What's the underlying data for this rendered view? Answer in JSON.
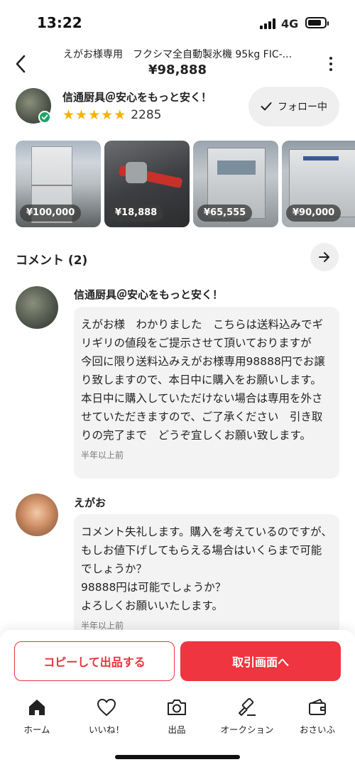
{
  "status_bar": {
    "time": "13:22",
    "network": "4G",
    "battery_level": 0.8
  },
  "header": {
    "title": "えがお様専用　フクシマ全自動製氷機 95kg FIC-...",
    "price": "¥98,888",
    "back_icon": "chevron-left-icon",
    "more_icon": "more-vertical-icon"
  },
  "seller": {
    "name": "信通厨具＠安心をもっと安く！",
    "rating_stars": 5,
    "rating_count": "2285",
    "follow_label": "フォロー中",
    "follow_icon": "check-icon"
  },
  "thumbnails": [
    {
      "price": "¥100,000"
    },
    {
      "price": "¥18,888"
    },
    {
      "price": "¥65,555"
    },
    {
      "price": "¥90,000"
    }
  ],
  "comments_section": {
    "title": "コメント (2)",
    "arrow_icon": "arrow-right-icon",
    "items": [
      {
        "author": "信通厨具＠安心をもっと安く！",
        "text": "えがお様　わかりました　こちらは送料込みでギリギリの値段をご提示させて頂いておりますが　今回に限り送料込みえがお様専用98888円でお譲り致しますので、本日中に購入をお願いします。本日中に購入していただけない場合は専用を外させていただきますので、ご了承ください　引き取りの完了まで　どうぞ宜しくお願い致します。",
        "time": "半年以上前"
      },
      {
        "author": "えがお",
        "text": "コメント失礼します。購入を考えているのですが、もしお値下げしてもらえる場合はいくらまで可能でしょうか？\n98888円は可能でしょうか？\nよろしくお願いいたします。",
        "time": "半年以上前"
      }
    ]
  },
  "actions": {
    "copy_label": "コピーして出品する",
    "trade_label": "取引画面へ",
    "brand_color": "#ee3540"
  },
  "tab_bar": [
    {
      "label": "ホーム",
      "icon": "home-icon"
    },
    {
      "label": "いいね！",
      "icon": "heart-icon"
    },
    {
      "label": "出品",
      "icon": "camera-icon"
    },
    {
      "label": "オークション",
      "icon": "gavel-icon"
    },
    {
      "label": "おさいふ",
      "icon": "wallet-icon"
    }
  ]
}
